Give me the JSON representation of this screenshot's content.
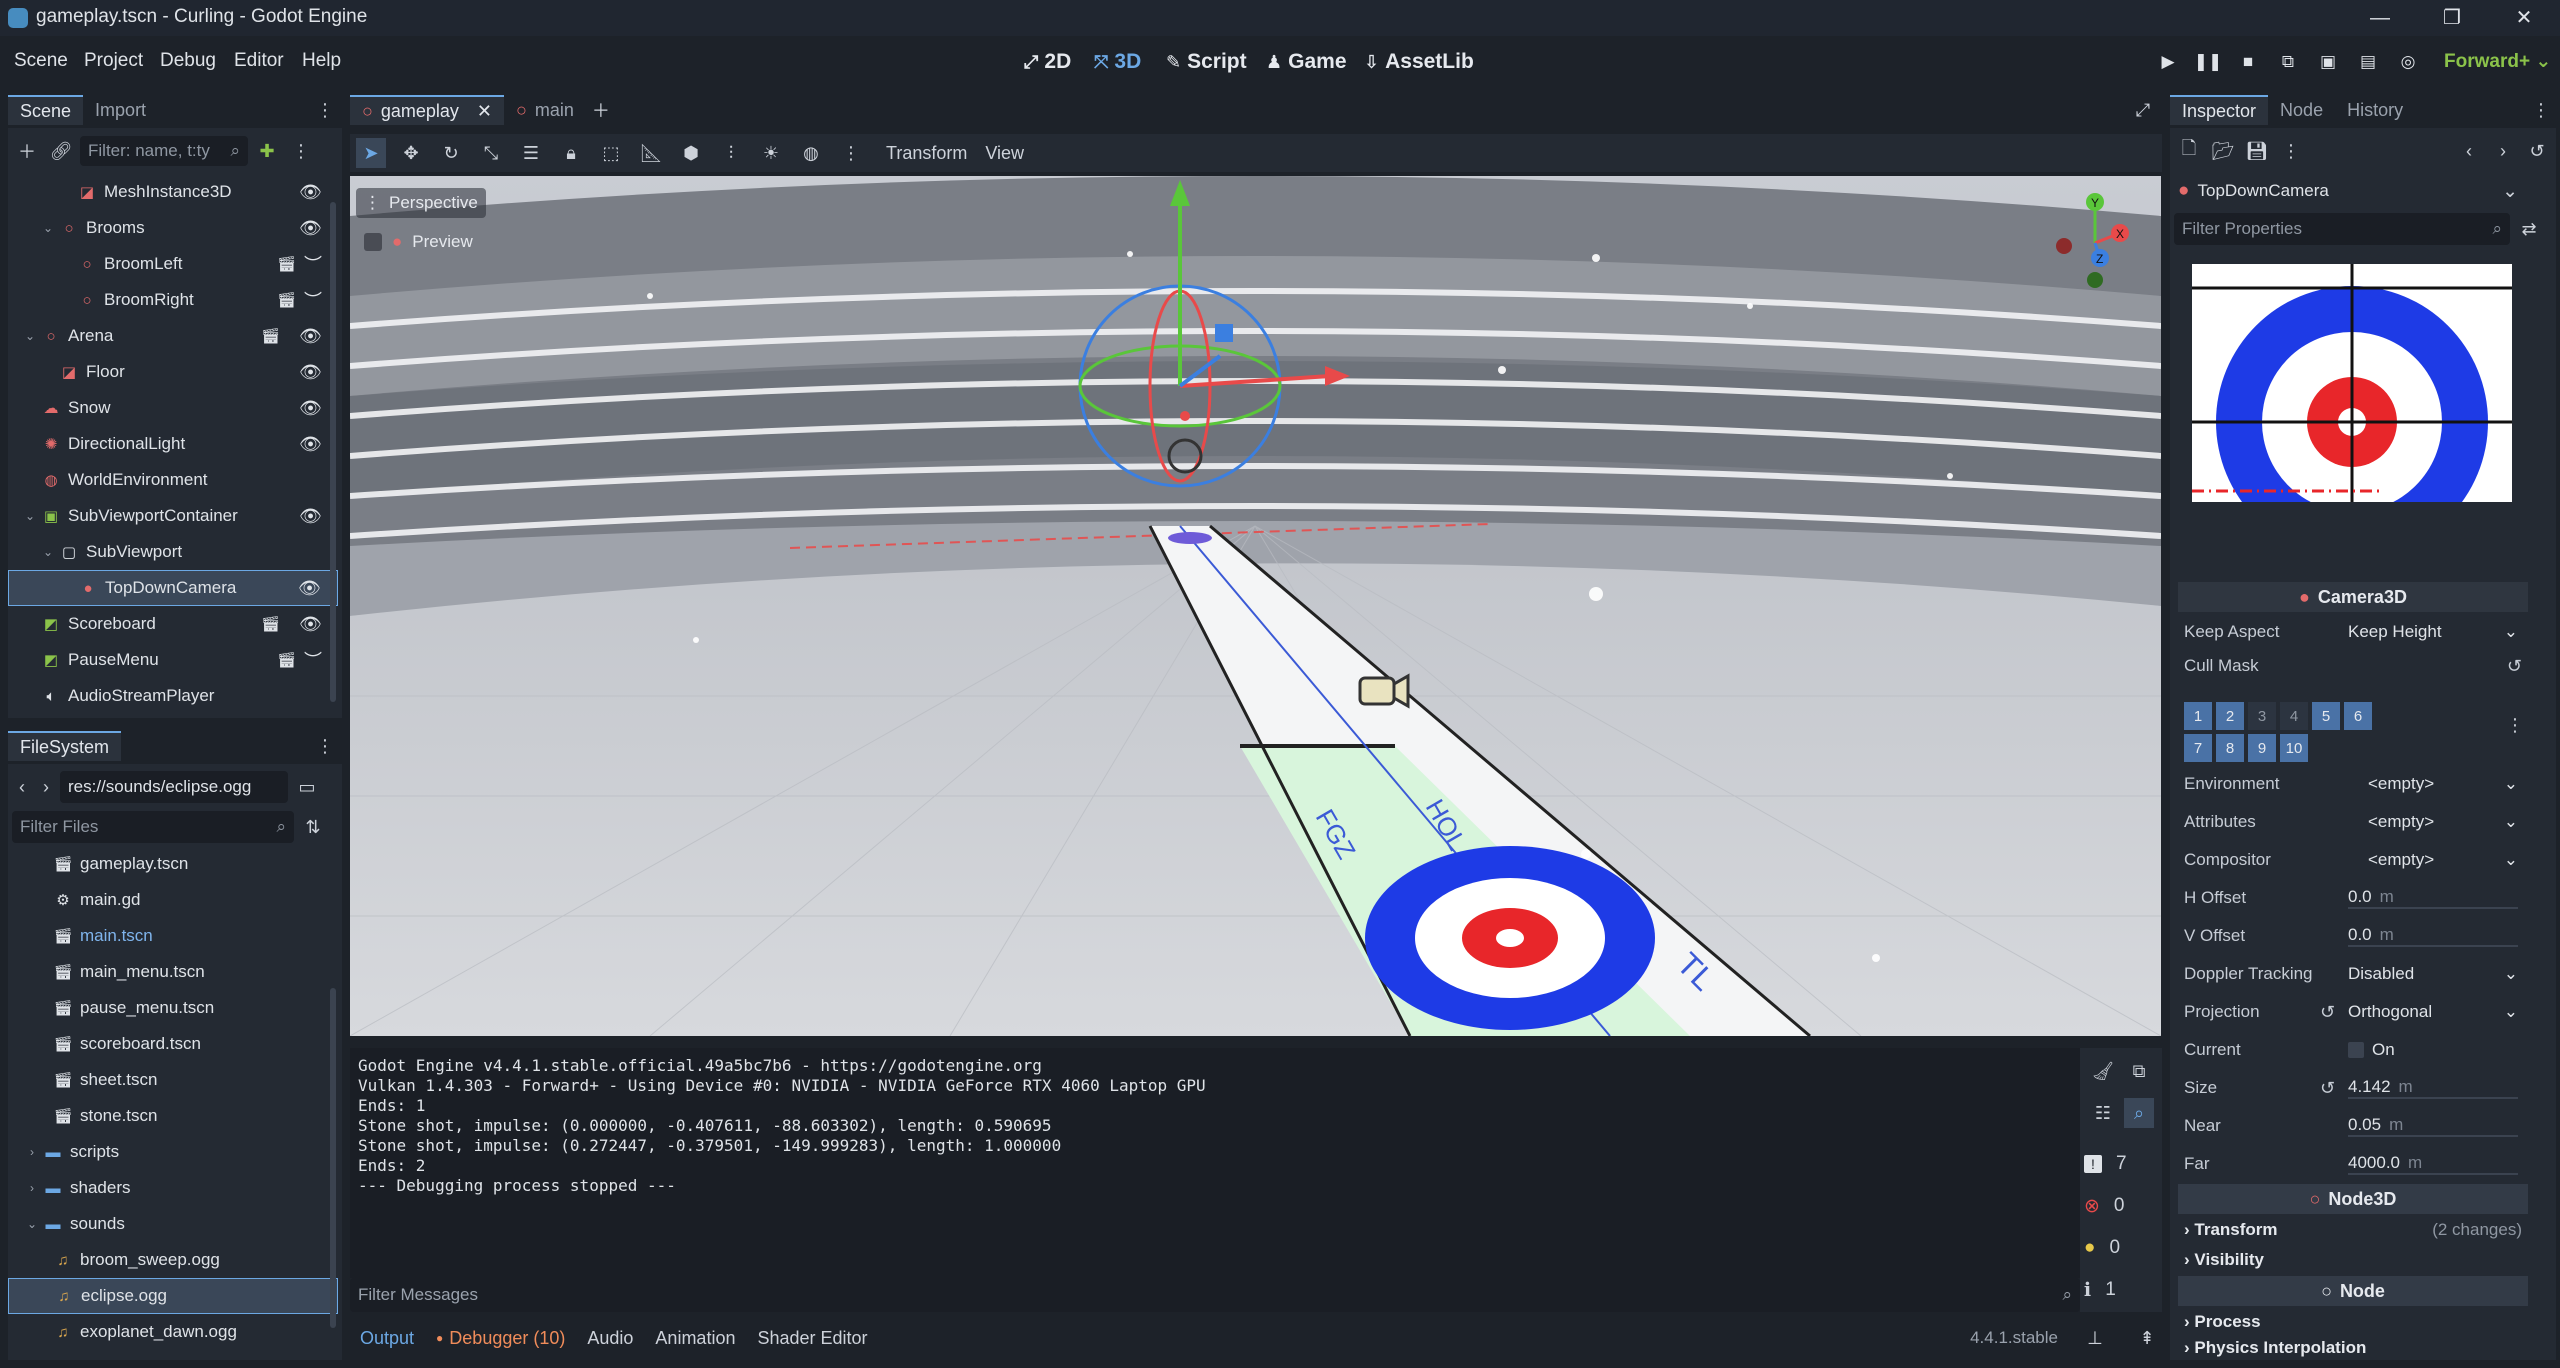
{
  "window": {
    "title": "gameplay.tscn - Curling - Godot Engine"
  },
  "menus": [
    "Scene",
    "Project",
    "Debug",
    "Editor",
    "Help"
  ],
  "workspaces": [
    {
      "label": "2D",
      "icon": "2d-icon"
    },
    {
      "label": "3D",
      "icon": "3d-icon"
    },
    {
      "label": "Script",
      "icon": "script-icon"
    },
    {
      "label": "Game",
      "icon": "game-icon"
    },
    {
      "label": "AssetLib",
      "icon": "assetlib-icon"
    }
  ],
  "renderer": "Forward+",
  "scene_dock": {
    "tabs": [
      "Scene",
      "Import"
    ],
    "filter_placeholder": "Filter: name, t:ty",
    "nodes": [
      {
        "name": "MeshInstance3D",
        "depth": 2,
        "icon": "mesh-icon",
        "eye": true
      },
      {
        "name": "Brooms",
        "depth": 1,
        "icon": "node3d-icon",
        "expanded": true,
        "eye": true
      },
      {
        "name": "BroomLeft",
        "depth": 2,
        "icon": "node3d-icon",
        "clap": true
      },
      {
        "name": "BroomRight",
        "depth": 2,
        "icon": "node3d-icon",
        "clap": true
      },
      {
        "name": "Arena",
        "depth": 0,
        "icon": "node3d-icon",
        "expanded": true,
        "clap": true,
        "eye": true
      },
      {
        "name": "Floor",
        "depth": 1,
        "icon": "mesh-icon",
        "eye": true
      },
      {
        "name": "Snow",
        "depth": 0,
        "icon": "particles-icon",
        "eye": true
      },
      {
        "name": "DirectionalLight",
        "depth": 0,
        "icon": "light-icon",
        "eye": true
      },
      {
        "name": "WorldEnvironment",
        "depth": 0,
        "icon": "world-icon"
      },
      {
        "name": "SubViewportContainer",
        "depth": 0,
        "icon": "container-icon",
        "expanded": true,
        "eye": true
      },
      {
        "name": "SubViewport",
        "depth": 1,
        "icon": "viewport-icon",
        "expanded": true
      },
      {
        "name": "TopDownCamera",
        "depth": 2,
        "icon": "camera-icon",
        "eye": true,
        "selected": true
      },
      {
        "name": "Scoreboard",
        "depth": 0,
        "icon": "control-icon",
        "clap": true,
        "eye": true
      },
      {
        "name": "PauseMenu",
        "depth": 0,
        "icon": "control-icon",
        "clap": true
      },
      {
        "name": "AudioStreamPlayer",
        "depth": 0,
        "icon": "audio-icon"
      }
    ]
  },
  "filesystem": {
    "title": "FileSystem",
    "path": "res://sounds/eclipse.ogg",
    "filter_placeholder": "Filter Files",
    "items": [
      {
        "name": "gameplay.tscn",
        "icon": "scene-file-icon",
        "depth": 1
      },
      {
        "name": "main.gd",
        "icon": "gear-icon",
        "depth": 1
      },
      {
        "name": "main.tscn",
        "icon": "scene-file-icon",
        "depth": 1,
        "current": true
      },
      {
        "name": "main_menu.tscn",
        "icon": "scene-file-icon",
        "depth": 1
      },
      {
        "name": "pause_menu.tscn",
        "icon": "scene-file-icon",
        "depth": 1
      },
      {
        "name": "scoreboard.tscn",
        "icon": "scene-file-icon",
        "depth": 1
      },
      {
        "name": "sheet.tscn",
        "icon": "scene-file-icon",
        "depth": 1
      },
      {
        "name": "stone.tscn",
        "icon": "scene-file-icon",
        "depth": 1
      },
      {
        "name": "scripts",
        "icon": "folder-icon",
        "depth": 0,
        "folder": true
      },
      {
        "name": "shaders",
        "icon": "folder-icon",
        "depth": 0,
        "folder": true
      },
      {
        "name": "sounds",
        "icon": "folder-icon",
        "depth": 0,
        "folder": true,
        "expanded": true
      },
      {
        "name": "broom_sweep.ogg",
        "icon": "audio-file-icon",
        "depth": 1
      },
      {
        "name": "eclipse.ogg",
        "icon": "audio-file-icon",
        "depth": 1,
        "selected": true
      },
      {
        "name": "exoplanet_dawn.ogg",
        "icon": "audio-file-icon",
        "depth": 1
      }
    ]
  },
  "editor_tabs": [
    {
      "label": "gameplay",
      "active": true
    },
    {
      "label": "main",
      "active": false
    }
  ],
  "viewport_toolbar": {
    "transform": "Transform",
    "view": "View"
  },
  "viewport": {
    "perspective_label": "Perspective",
    "preview_label": "Preview",
    "sheet_labels": [
      "HOL",
      "FGZ",
      "TL"
    ],
    "gizmo_axes": [
      "Y",
      "Z",
      "X"
    ]
  },
  "output": {
    "lines": [
      "Godot Engine v4.4.1.stable.official.49a5bc7b6 - https://godotengine.org",
      "Vulkan 1.4.303 - Forward+ - Using Device #0: NVIDIA - NVIDIA GeForce RTX 4060 Laptop GPU",
      "",
      "Ends: 1",
      "Stone shot, impulse: (0.000000, -0.407611, -88.603302), length: 0.590695",
      "Stone shot, impulse: (0.272447, -0.379501, -149.999283), length: 1.000000",
      "Ends: 2",
      "--- Debugging process stopped ---"
    ],
    "filter_placeholder": "Filter Messages",
    "counts": {
      "messages": "7",
      "errors": "0",
      "warnings": "0",
      "info": "1"
    }
  },
  "bottom_tabs": [
    "Output",
    "Debugger (10)",
    "Audio",
    "Animation",
    "Shader Editor"
  ],
  "version": "4.4.1.stable",
  "inspector": {
    "tabs": [
      "Inspector",
      "Node",
      "History"
    ],
    "node_name": "TopDownCamera",
    "filter_placeholder": "Filter Properties",
    "class_header": "Camera3D",
    "properties": [
      {
        "label": "Keep Aspect",
        "value": "Keep Height",
        "dropdown": true
      },
      {
        "label": "Cull Mask",
        "value": ""
      },
      {
        "label": "Environment",
        "value": "<empty>",
        "dropdown": true
      },
      {
        "label": "Attributes",
        "value": "<empty>",
        "dropdown": true
      },
      {
        "label": "Compositor",
        "value": "<empty>",
        "dropdown": true
      },
      {
        "label": "H Offset",
        "value": "0.0",
        "unit": "m"
      },
      {
        "label": "V Offset",
        "value": "0.0",
        "unit": "m"
      },
      {
        "label": "Doppler Tracking",
        "value": "Disabled",
        "dropdown": true
      },
      {
        "label": "Projection",
        "value": "Orthogonal",
        "dropdown": true,
        "revert": true
      },
      {
        "label": "Current",
        "value": "On",
        "checkbox": true
      },
      {
        "label": "Size",
        "value": "4.142",
        "unit": "m",
        "revert": true
      },
      {
        "label": "Near",
        "value": "0.05",
        "unit": "m"
      },
      {
        "label": "Far",
        "value": "4000.0",
        "unit": "m"
      }
    ],
    "cull_layers": [
      "1",
      "2",
      "3",
      "4",
      "5",
      "6",
      "7",
      "8",
      "9",
      "10"
    ],
    "cull_layers_off": [
      "3",
      "4"
    ],
    "node3d_header": "Node3D",
    "transform_label": "Transform",
    "transform_changes": "(2 changes)",
    "visibility_label": "Visibility",
    "node_header": "Node",
    "process_label": "Process",
    "physics_label": "Physics Interpolation"
  },
  "colors": {
    "accent": "#6ca8e4",
    "bg": "#1d2229",
    "panel": "#242a33",
    "target_blue": "#1e3be6",
    "target_red": "#e8262a",
    "sheet_green": "#d8f5dc"
  }
}
